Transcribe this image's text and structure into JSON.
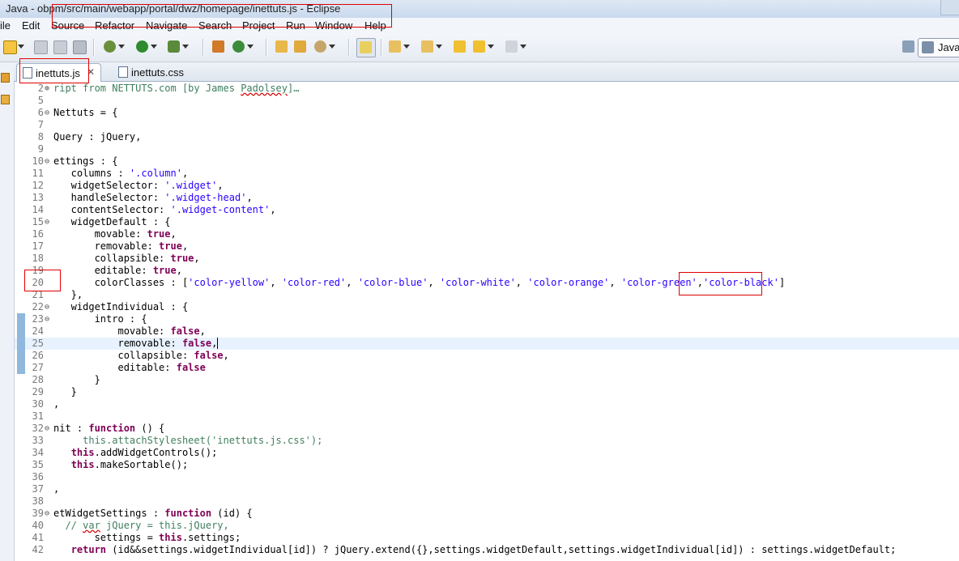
{
  "window": {
    "title": "Java - obpm/src/main/webapp/portal/dwz/homepage/inettuts.js - Eclipse"
  },
  "menu": {
    "items": [
      "ile",
      "Edit",
      "Source",
      "Refactor",
      "Navigate",
      "Search",
      "Project",
      "Run",
      "Window",
      "Help"
    ]
  },
  "toolbar": {
    "perspective_label": "Java"
  },
  "tabs": [
    {
      "label": "inettuts.js",
      "active": true
    },
    {
      "label": "inettuts.css",
      "active": false
    }
  ],
  "editor": {
    "current_line": 25,
    "lines": [
      {
        "n": "2",
        "fold": "⊕",
        "tokens": [
          {
            "t": "ript from NETTUTS.com [by James ",
            "c": "cmt"
          },
          {
            "t": "Padolsey",
            "c": "cmt warn"
          },
          {
            "t": "]",
            "c": "cmt"
          },
          {
            "t": "…",
            "c": "cmt"
          }
        ]
      },
      {
        "n": "5",
        "tokens": []
      },
      {
        "n": "6",
        "fold": "⊖",
        "tokens": [
          {
            "t": "Nettuts = {",
            "c": "plain"
          }
        ]
      },
      {
        "n": "7",
        "tokens": []
      },
      {
        "n": "8",
        "tokens": [
          {
            "t": "Query : jQuery,",
            "c": "plain"
          }
        ]
      },
      {
        "n": "9",
        "tokens": []
      },
      {
        "n": "10",
        "fold": "⊖",
        "tokens": [
          {
            "t": "ettings : {",
            "c": "plain"
          }
        ]
      },
      {
        "n": "11",
        "tokens": [
          {
            "t": "   columns : ",
            "c": "plain"
          },
          {
            "t": "'.column'",
            "c": "str"
          },
          {
            "t": ",",
            "c": "plain"
          }
        ]
      },
      {
        "n": "12",
        "tokens": [
          {
            "t": "   widgetSelector: ",
            "c": "plain"
          },
          {
            "t": "'.widget'",
            "c": "str"
          },
          {
            "t": ",",
            "c": "plain"
          }
        ]
      },
      {
        "n": "13",
        "tokens": [
          {
            "t": "   handleSelector: ",
            "c": "plain"
          },
          {
            "t": "'.widget-head'",
            "c": "str"
          },
          {
            "t": ",",
            "c": "plain"
          }
        ]
      },
      {
        "n": "14",
        "tokens": [
          {
            "t": "   contentSelector: ",
            "c": "plain"
          },
          {
            "t": "'.widget-content'",
            "c": "str"
          },
          {
            "t": ",",
            "c": "plain"
          }
        ]
      },
      {
        "n": "15",
        "fold": "⊖",
        "tokens": [
          {
            "t": "   widgetDefault : {",
            "c": "plain"
          }
        ]
      },
      {
        "n": "16",
        "tokens": [
          {
            "t": "       movable: ",
            "c": "plain"
          },
          {
            "t": "true",
            "c": "kw"
          },
          {
            "t": ",",
            "c": "plain"
          }
        ]
      },
      {
        "n": "17",
        "tokens": [
          {
            "t": "       removable: ",
            "c": "plain"
          },
          {
            "t": "true",
            "c": "kw"
          },
          {
            "t": ",",
            "c": "plain"
          }
        ]
      },
      {
        "n": "18",
        "tokens": [
          {
            "t": "       collapsible: ",
            "c": "plain"
          },
          {
            "t": "true",
            "c": "kw"
          },
          {
            "t": ",",
            "c": "plain"
          }
        ]
      },
      {
        "n": "19",
        "tokens": [
          {
            "t": "       editable: ",
            "c": "plain"
          },
          {
            "t": "true",
            "c": "kw"
          },
          {
            "t": ",",
            "c": "plain"
          }
        ]
      },
      {
        "n": "20",
        "tokens": [
          {
            "t": "       colorClasses : [",
            "c": "plain"
          },
          {
            "t": "'color-yellow'",
            "c": "str"
          },
          {
            "t": ", ",
            "c": "plain"
          },
          {
            "t": "'color-red'",
            "c": "str"
          },
          {
            "t": ", ",
            "c": "plain"
          },
          {
            "t": "'color-blue'",
            "c": "str"
          },
          {
            "t": ", ",
            "c": "plain"
          },
          {
            "t": "'color-white'",
            "c": "str"
          },
          {
            "t": ", ",
            "c": "plain"
          },
          {
            "t": "'color-orange'",
            "c": "str"
          },
          {
            "t": ", ",
            "c": "plain"
          },
          {
            "t": "'color-green'",
            "c": "str"
          },
          {
            "t": ",",
            "c": "plain"
          },
          {
            "t": "'color-black'",
            "c": "str"
          },
          {
            "t": "]",
            "c": "plain"
          }
        ]
      },
      {
        "n": "21",
        "tokens": [
          {
            "t": "   },",
            "c": "plain"
          }
        ]
      },
      {
        "n": "22",
        "fold": "⊖",
        "tokens": [
          {
            "t": "   widgetIndividual : {",
            "c": "plain"
          }
        ]
      },
      {
        "n": "23",
        "fold": "⊖",
        "change": true,
        "tokens": [
          {
            "t": "       intro : {",
            "c": "plain"
          }
        ]
      },
      {
        "n": "24",
        "change": true,
        "tokens": [
          {
            "t": "           movable: ",
            "c": "plain"
          },
          {
            "t": "false",
            "c": "kw"
          },
          {
            "t": ",",
            "c": "plain"
          }
        ]
      },
      {
        "n": "25",
        "change": true,
        "tokens": [
          {
            "t": "           removable: ",
            "c": "plain"
          },
          {
            "t": "false",
            "c": "kw"
          },
          {
            "t": ",",
            "c": "plain cursor"
          }
        ]
      },
      {
        "n": "26",
        "change": true,
        "tokens": [
          {
            "t": "           collapsible: ",
            "c": "plain"
          },
          {
            "t": "false",
            "c": "kw"
          },
          {
            "t": ",",
            "c": "plain"
          }
        ]
      },
      {
        "n": "27",
        "change": true,
        "tokens": [
          {
            "t": "           editable: ",
            "c": "plain"
          },
          {
            "t": "false",
            "c": "kw"
          }
        ]
      },
      {
        "n": "28",
        "tokens": [
          {
            "t": "       }",
            "c": "plain"
          }
        ]
      },
      {
        "n": "29",
        "tokens": [
          {
            "t": "   }",
            "c": "plain"
          }
        ]
      },
      {
        "n": "30",
        "tokens": [
          {
            "t": ",",
            "c": "plain"
          }
        ]
      },
      {
        "n": "31",
        "tokens": []
      },
      {
        "n": "32",
        "fold": "⊖",
        "tokens": [
          {
            "t": "nit : ",
            "c": "plain"
          },
          {
            "t": "function",
            "c": "kw"
          },
          {
            "t": " () {",
            "c": "plain"
          }
        ]
      },
      {
        "n": "33",
        "tokens": [
          {
            "t": "     this.attachStylesheet(",
            "c": "cmt"
          },
          {
            "t": "'inettuts.js.css'",
            "c": "cmt"
          },
          {
            "t": ");",
            "c": "cmt"
          }
        ]
      },
      {
        "n": "34",
        "tokens": [
          {
            "t": "   ",
            "c": "plain"
          },
          {
            "t": "this",
            "c": "kw"
          },
          {
            "t": ".addWidgetControls();",
            "c": "plain"
          }
        ]
      },
      {
        "n": "35",
        "tokens": [
          {
            "t": "   ",
            "c": "plain"
          },
          {
            "t": "this",
            "c": "kw"
          },
          {
            "t": ".makeSortable();",
            "c": "plain"
          }
        ]
      },
      {
        "n": "36",
        "tokens": []
      },
      {
        "n": "37",
        "tokens": [
          {
            "t": ",",
            "c": "plain"
          }
        ]
      },
      {
        "n": "38",
        "tokens": []
      },
      {
        "n": "39",
        "fold": "⊖",
        "tokens": [
          {
            "t": "etWidgetSettings : ",
            "c": "plain"
          },
          {
            "t": "function",
            "c": "kw"
          },
          {
            "t": " (id) {",
            "c": "plain"
          }
        ]
      },
      {
        "n": "40",
        "tokens": [
          {
            "t": "  // ",
            "c": "cmt"
          },
          {
            "t": "var",
            "c": "cmt warn"
          },
          {
            "t": " jQuery = this.jQuery,",
            "c": "cmt"
          }
        ]
      },
      {
        "n": "41",
        "tokens": [
          {
            "t": "       settings = ",
            "c": "plain"
          },
          {
            "t": "this",
            "c": "kw"
          },
          {
            "t": ".settings;",
            "c": "plain"
          }
        ]
      },
      {
        "n": "42",
        "tokens": [
          {
            "t": "   ",
            "c": "plain"
          },
          {
            "t": "return",
            "c": "kw"
          },
          {
            "t": " (id&&settings.widgetIndividual[id]) ? jQuery.extend({},settings.widgetDefault,settings.widgetIndividual[id]) : settings.widgetDefault;",
            "c": "plain"
          }
        ]
      }
    ]
  }
}
